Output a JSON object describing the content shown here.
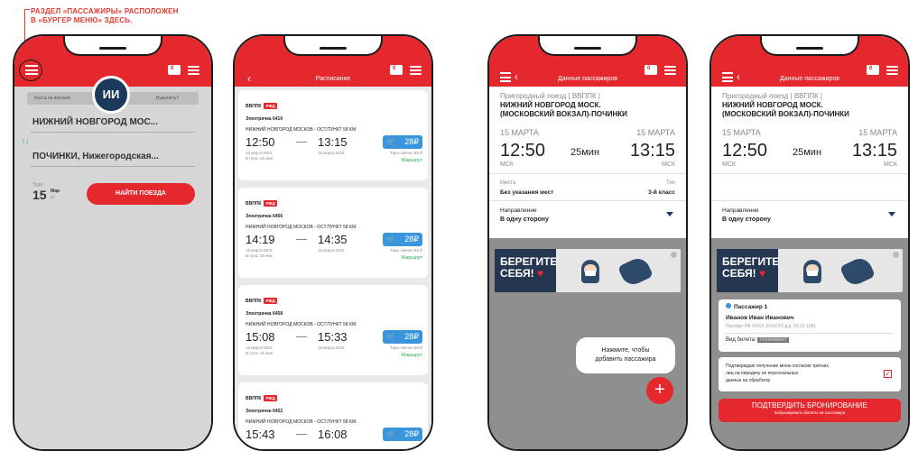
{
  "annotation": {
    "line1": "РАЗДЕЛ «ПАССАЖИРЫ» РАСПОЛОЖЕН",
    "line2": "В «БУРГЕР МЕНЮ» ЗДЕСЬ."
  },
  "colors": {
    "brand_red": "#e4282d",
    "price_blue": "#3b95dc",
    "banner_navy": "#253750",
    "overlay_grey": "#d6d6d6"
  },
  "icons": {
    "menu": "burger-menu-icon",
    "cart": "cart-icon",
    "filter": "filter-icon",
    "back": "back-arrow-icon",
    "swap": "swap-icon",
    "dropdown": "dropdown-arrow-icon",
    "add": "plus-icon",
    "checkbox": "checkbox-icon"
  },
  "cart_count": "0",
  "p1": {
    "avatar": "ИИ",
    "tab_left": "Касса на вокзале",
    "tab_right": "Выкупить?",
    "from": "НИЖНИЙ НОВГОРОД МОС...",
    "swap": "↑↓",
    "to": "ПОЧИНКИ, Нижегородская...",
    "dir_label": "Туда",
    "day": "15",
    "month": "Мар",
    "weekday": "Вт",
    "search_button": "НАЙТИ ПОЕЗДА"
  },
  "p2": {
    "title": "Расписание",
    "trains": [
      {
        "carrier": "ВВППК",
        "logo": "РЖД",
        "number": "Электричка 6410",
        "route": "НИЖНИЙ НОВГОРОД МОСКОВ - ОСТ.ПУНКТ 58 КМ.",
        "dep": "12:50",
        "arr": "13:15",
        "dep_date": "15 марта",
        "dep_tz": "МСК",
        "arr_date": "15 марта",
        "arr_tz": "МСК",
        "dur": "В пути: 25 мин",
        "price": "28",
        "cur": "₽",
        "seats": "Тарь-свечно 58 ₽",
        "link": "Маршрут"
      },
      {
        "carrier": "ВВППК",
        "logo": "РЖД",
        "number": "Электричка 6456",
        "route": "НИЖНИЙ НОВГОРОД МОСКОВ - ОСТ.ПУНКТ 58 КМ.",
        "dep": "14:19",
        "arr": "14:35",
        "dep_date": "15 марта",
        "dep_tz": "МСК",
        "arr_date": "15 марта",
        "arr_tz": "МСК",
        "dur": "В пути: 25 мин",
        "price": "28",
        "cur": "₽",
        "seats": "Тарь-свечно 58 ₽",
        "link": "Маршрут"
      },
      {
        "carrier": "ВВППК",
        "logo": "РЖД",
        "number": "Электричка 6458",
        "route": "НИЖНИЙ НОВГОРОД МОСКОВ - ОСТ.ПУНКТ 58 КМ.",
        "dep": "15:08",
        "arr": "15:33",
        "dep_date": "15 марта",
        "dep_tz": "МСК",
        "arr_date": "15 марта",
        "arr_tz": "МСК",
        "dur": "В пути: 25 мин",
        "price": "28",
        "cur": "₽",
        "seats": "Тарь-свечно 58 ₽",
        "link": "Маршрут"
      },
      {
        "carrier": "ВВППК",
        "logo": "РЖД",
        "number": "Электричка 6452",
        "route": "НИЖНИЙ НОВГОРОД МОСКОВ - ОСТ.ПУНКТ 58 КМ.",
        "dep": "15:43",
        "arr": "16:08",
        "dep_date": "",
        "dep_tz": "",
        "arr_date": "",
        "arr_tz": "",
        "dur": "",
        "price": "28",
        "cur": "₽",
        "seats": "",
        "link": ""
      }
    ]
  },
  "pd": {
    "title": "Данные пассажиров",
    "train_type": "Пригородный поезд | ВВППК |",
    "route_line1": "НИЖНИЙ НОВГОРОД МОСК.",
    "route_line2": "(МОСКОВСКИЙ ВОКЗАЛ)-ПОЧИНКИ",
    "dep_date": "15 МАРТА",
    "arr_date": "15 МАРТА",
    "dep": "12:50",
    "arr": "13:15",
    "dur": "25мин",
    "dep_tz": "МСК",
    "arr_tz": "МСК",
    "seats_label": "Места",
    "seats_value": "Без указания мест",
    "type_label": "Тип",
    "type_value": "3-й класс",
    "direction_label": "Направление",
    "direction_value": "В одну сторону",
    "banner_l1": "БЕРЕГИТЕ",
    "banner_l2": "СЕБЯ!"
  },
  "p3": {
    "tooltip_l1": "Нажмите, чтобы",
    "tooltip_l2": "добавить пассажира",
    "add": "+"
  },
  "p4": {
    "passenger_title": "Пассажир 1",
    "passenger_name": "Иванов Иван Иванович",
    "passport": "Паспорт РФ XXXX XXXXXX д.р. 01.02.1991",
    "ticket_label": "Вид билета:",
    "ticket_value": "Абонемент",
    "consent_l1": "Подтверждаю получение мною согласия третьих",
    "consent_l2": "лиц на передачу их персональных",
    "consent_l3": "данных на обработку",
    "confirm": "ПОДТВЕРДИТЬ БРОНИРОВАНИЕ",
    "confirm_sub": "Забронировать билеты на пассажира"
  }
}
